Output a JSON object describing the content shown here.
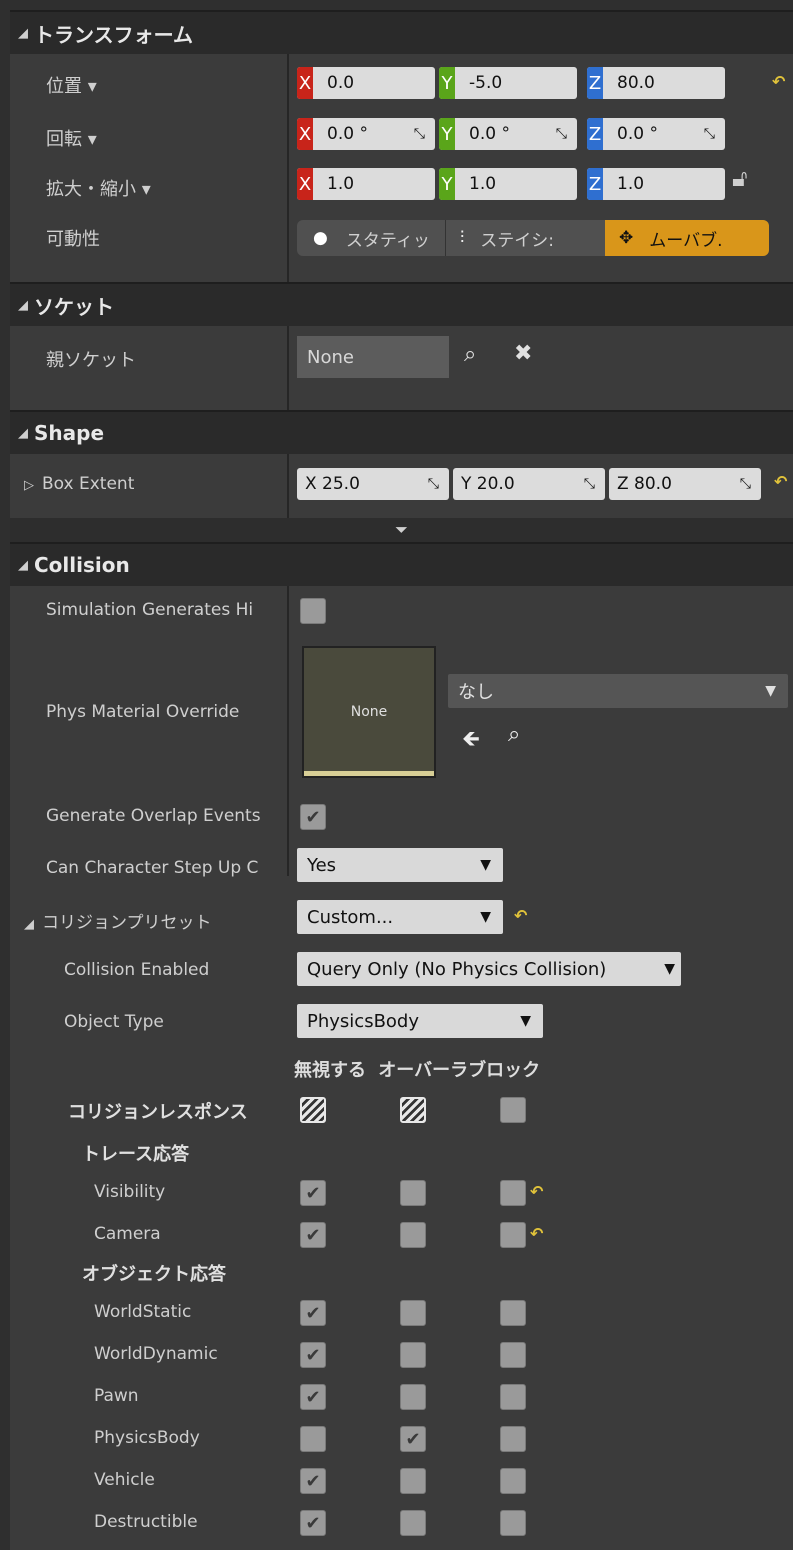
{
  "transform": {
    "title": "トランスフォーム",
    "location_label": "位置 ▾",
    "rotation_label": "回転 ▾",
    "scale_label": "拡大・縮小 ▾",
    "mobility_label": "可動性",
    "location": {
      "x": "0.0",
      "y": "-5.0",
      "z": "80.0"
    },
    "rotation": {
      "x": "0.0 °",
      "y": "0.0 °",
      "z": "0.0 °"
    },
    "scale": {
      "x": "1.0",
      "y": "1.0",
      "z": "1.0"
    },
    "mobility": {
      "static": "スタティッ",
      "stationary": "ステイシ:",
      "movable": "ムーバブ."
    }
  },
  "socket": {
    "title": "ソケット",
    "parent_label": "親ソケット",
    "parent_value": "None"
  },
  "shape": {
    "title": "Shape",
    "box_extent_label": "Box Extent",
    "box_extent": {
      "x": "X  25.0",
      "y": "Y  20.0",
      "z": "Z  80.0"
    }
  },
  "collision": {
    "title": "Collision",
    "sim_hit_label": "Simulation Generates Hi",
    "phys_material_label": "Phys Material Override",
    "phys_material_thumb": "None",
    "phys_material_value": "なし",
    "overlap_label": "Generate Overlap Events",
    "step_up_label": "Can Character Step Up C",
    "step_up_value": "Yes",
    "preset_label": "コリジョンプリセット",
    "preset_value": "Custom...",
    "enabled_label": "Collision Enabled",
    "enabled_value": "Query Only (No Physics Collision)",
    "object_type_label": "Object Type",
    "object_type_value": "PhysicsBody",
    "columns_header": "無視する オーバーラブロック",
    "responses_label": "コリジョンレスポンス",
    "trace_header": "トレース応答",
    "object_header": "オブジェクト応答",
    "trace_rows": [
      {
        "name": "Visibility",
        "ignore": true,
        "overlap": false,
        "block": false
      },
      {
        "name": "Camera",
        "ignore": true,
        "overlap": false,
        "block": false
      }
    ],
    "object_rows": [
      {
        "name": "WorldStatic",
        "ignore": true,
        "overlap": false,
        "block": false
      },
      {
        "name": "WorldDynamic",
        "ignore": true,
        "overlap": false,
        "block": false
      },
      {
        "name": "Pawn",
        "ignore": true,
        "overlap": false,
        "block": false
      },
      {
        "name": "PhysicsBody",
        "ignore": false,
        "overlap": true,
        "block": false
      },
      {
        "name": "Vehicle",
        "ignore": true,
        "overlap": false,
        "block": false
      },
      {
        "name": "Destructible",
        "ignore": true,
        "overlap": false,
        "block": false
      }
    ]
  }
}
